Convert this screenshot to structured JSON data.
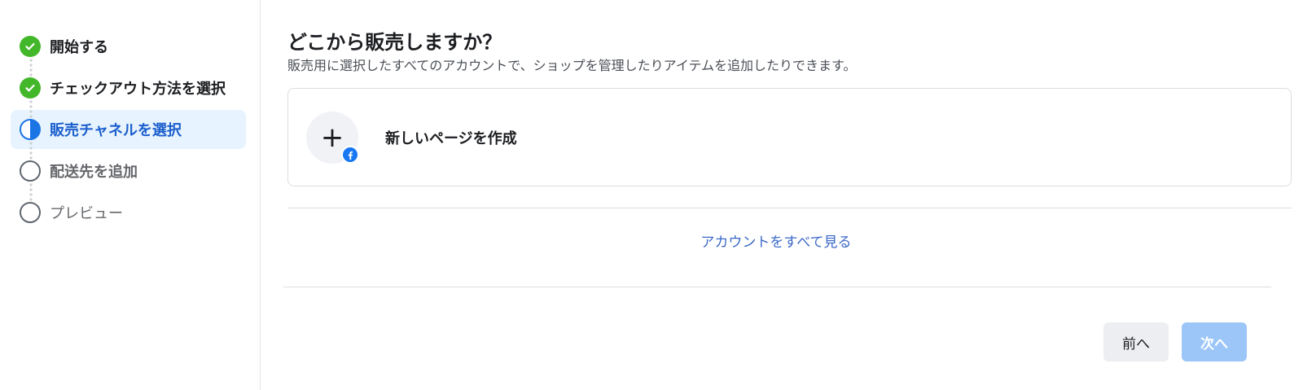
{
  "steps": [
    {
      "label": "開始する",
      "status": "done"
    },
    {
      "label": "チェックアウト方法を選択",
      "status": "done"
    },
    {
      "label": "販売チャネルを選択",
      "status": "current"
    },
    {
      "label": "配送先を追加",
      "status": "pending"
    },
    {
      "label": "プレビュー",
      "status": "pending"
    }
  ],
  "main": {
    "title": "どこから販売しますか？",
    "subtitle": "販売用に選択したすべてのアカウントで、ショップを管理したりアイテムを追加したりできます。",
    "create_card": {
      "label": "新しいページを作成",
      "icon": "plus-icon",
      "badge_icon": "facebook-icon"
    },
    "see_all_link": "アカウントをすべて見る"
  },
  "footer": {
    "prev_label": "前へ",
    "next_label": "次へ",
    "next_enabled": false
  },
  "colors": {
    "accent": "#1b74e4",
    "done": "#42b72a",
    "link": "#3b68c8",
    "facebook": "#1877f2"
  }
}
